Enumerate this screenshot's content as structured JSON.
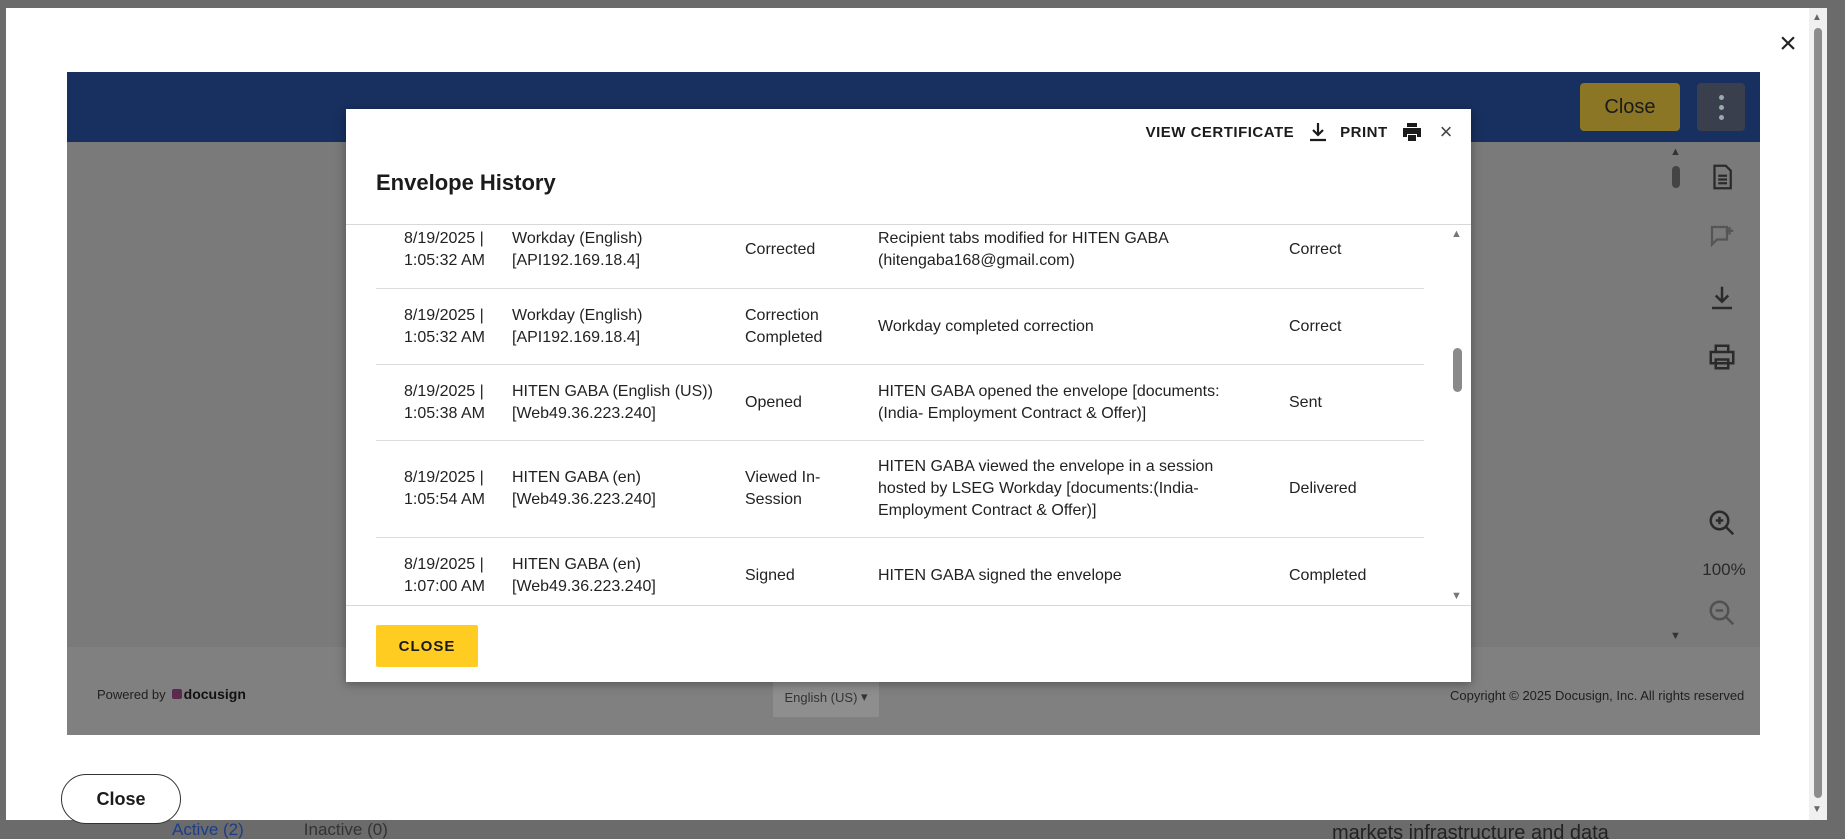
{
  "background": {
    "tabs": [
      "Active (2)",
      "Inactive (0)"
    ],
    "right_text": "markets infrastructure and data"
  },
  "viewer": {
    "header_close_label": "Close",
    "zoom_level": "100%",
    "footer": {
      "powered_by": "Powered by",
      "brand": "docusign",
      "language": "English (US)",
      "copyright": "Copyright © 2025 Docusign, Inc. All rights reserved"
    }
  },
  "outer_close_label": "Close",
  "dialog": {
    "title": "Envelope History",
    "toolbar": {
      "view_certificate": "VIEW CERTIFICATE",
      "print": "PRINT"
    },
    "close_label": "CLOSE",
    "rows": [
      {
        "time": [
          "8/19/2025 |",
          "1:05:32 AM"
        ],
        "user": [
          "Workday (English)",
          "[API192.169.18.4]"
        ],
        "action": "Corrected",
        "details": [
          "Recipient tabs modified for HITEN GABA",
          "(hitengaba168@gmail.com)"
        ],
        "status": "Correct"
      },
      {
        "time": [
          "8/19/2025 |",
          "1:05:32 AM"
        ],
        "user": [
          "Workday (English)",
          "[API192.169.18.4]"
        ],
        "action": "Correction Completed",
        "details": [
          "Workday completed correction"
        ],
        "status": "Correct"
      },
      {
        "time": [
          "8/19/2025 |",
          "1:05:38 AM"
        ],
        "user": [
          "HITEN GABA (English (US))",
          "[Web49.36.223.240]"
        ],
        "action": "Opened",
        "details": [
          "HITEN GABA opened the envelope [documents:",
          "(India- Employment Contract & Offer)]"
        ],
        "status": "Sent"
      },
      {
        "time": [
          "8/19/2025 |",
          "1:05:54 AM"
        ],
        "user": [
          "HITEN GABA (en)",
          "[Web49.36.223.240]"
        ],
        "action": "Viewed In-Session",
        "details": [
          "HITEN GABA viewed the envelope in a session",
          "hosted by LSEG Workday [documents:(India-",
          "Employment Contract & Offer)]"
        ],
        "status": "Delivered"
      },
      {
        "time": [
          "8/19/2025 |",
          "1:07:00 AM"
        ],
        "user": [
          "HITEN GABA (en)",
          "[Web49.36.223.240]"
        ],
        "action": "Signed",
        "details": [
          "HITEN GABA signed the envelope"
        ],
        "status": "Completed"
      }
    ]
  },
  "colors": {
    "header_navy": "#17305f",
    "accent_yellow": "#ffcc22"
  }
}
